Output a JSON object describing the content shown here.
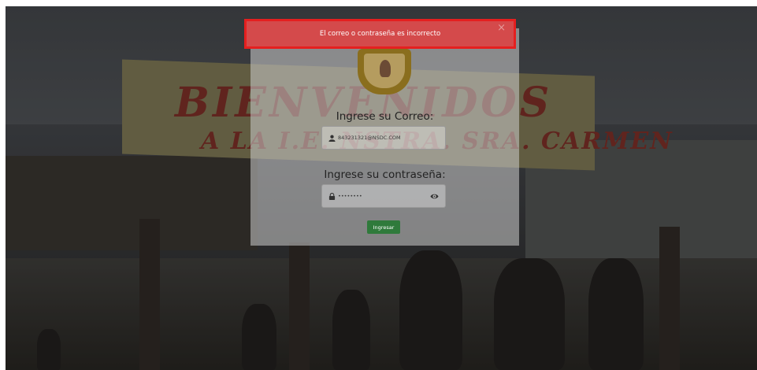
{
  "alert": {
    "message": "El correo o contraseña es incorrecto",
    "close_symbol": "×",
    "background_color": "#d44a4b",
    "border_color": "#e51f1f"
  },
  "login": {
    "email_label": "Ingrese su Correo:",
    "email_value": "843231321@NSDC.COM",
    "password_label": "Ingrese su contraseña:",
    "password_value": "••••••••",
    "submit_label": "Ingresar",
    "submit_color": "#2f7a3b"
  },
  "background": {
    "banner_line1": "BIENVENIDOS",
    "banner_line2": "A LA I.E. NSTRA. SRA. CARMEN"
  },
  "icons": {
    "email_field_icon": "user-icon",
    "password_field_icon": "lock-icon",
    "toggle_password_icon": "eye-icon",
    "logo": "school-crest"
  }
}
